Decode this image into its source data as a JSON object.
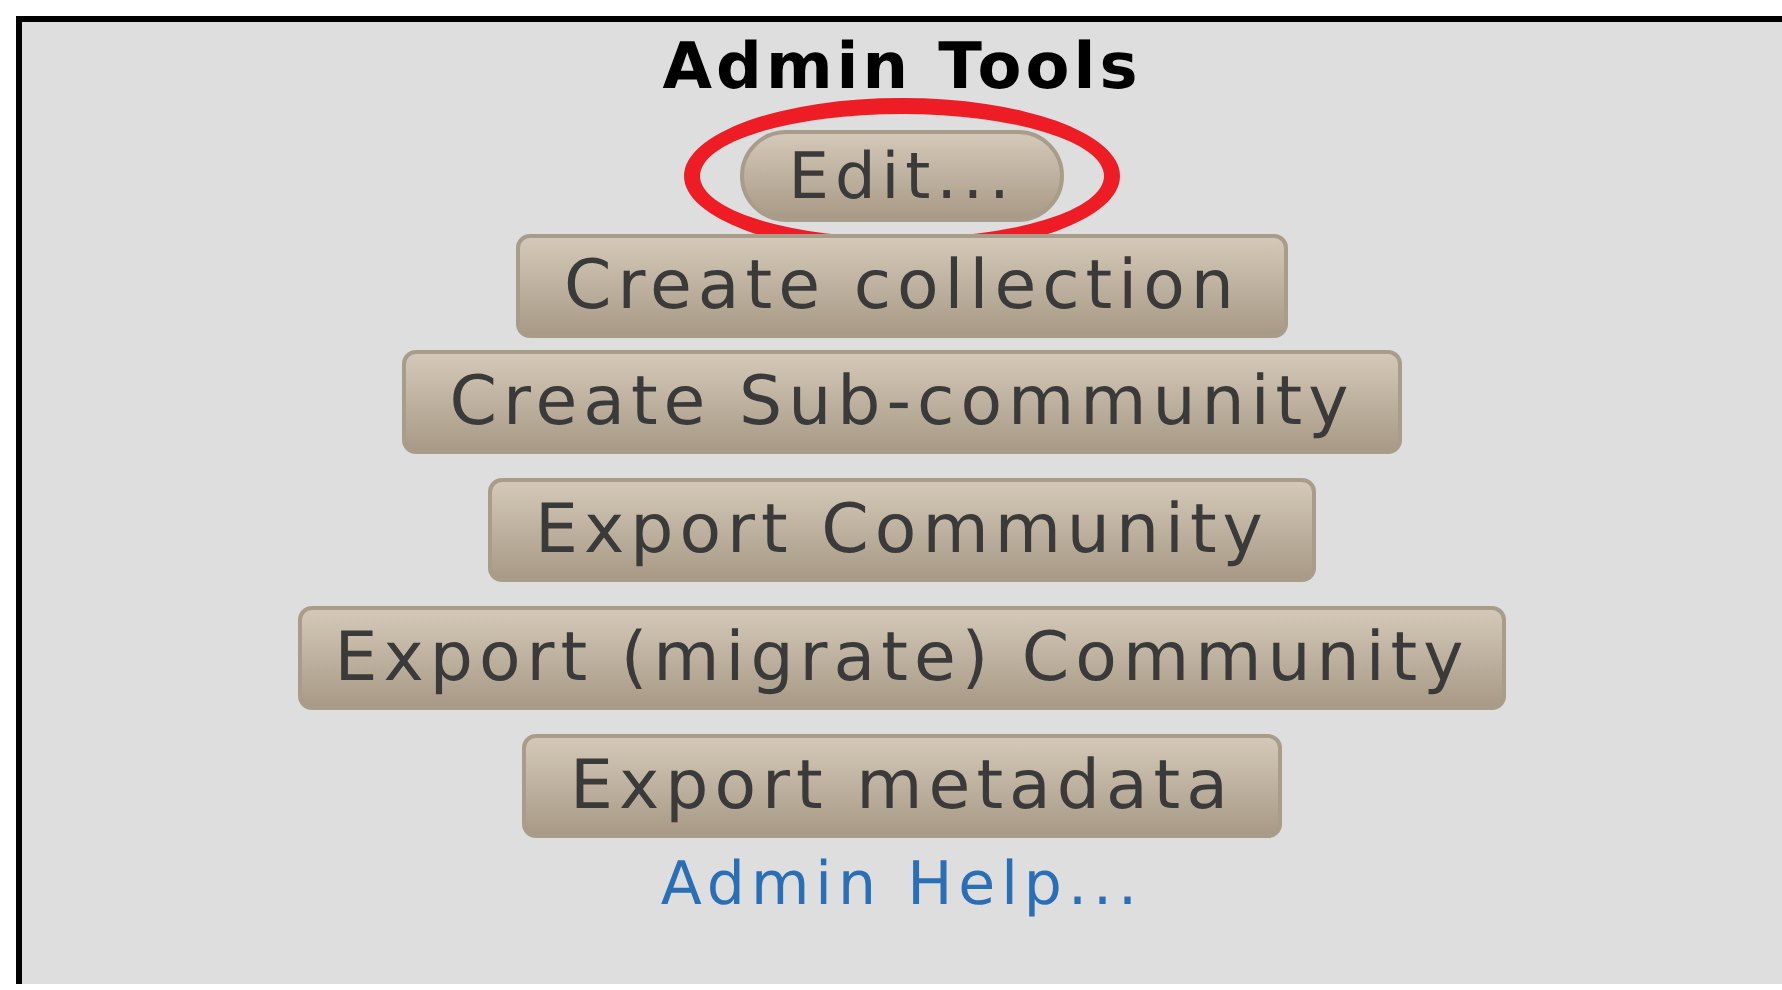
{
  "panel": {
    "title": "Admin Tools",
    "buttons": [
      {
        "label": "Edit...",
        "highlighted": true
      },
      {
        "label": "Create collection",
        "highlighted": false
      },
      {
        "label": "Create Sub-community",
        "highlighted": false
      },
      {
        "label": "Export Community",
        "highlighted": false
      },
      {
        "label": "Export (migrate) Community",
        "highlighted": false
      },
      {
        "label": "Export metadata",
        "highlighted": false
      }
    ],
    "help_link": "Admin Help..."
  }
}
